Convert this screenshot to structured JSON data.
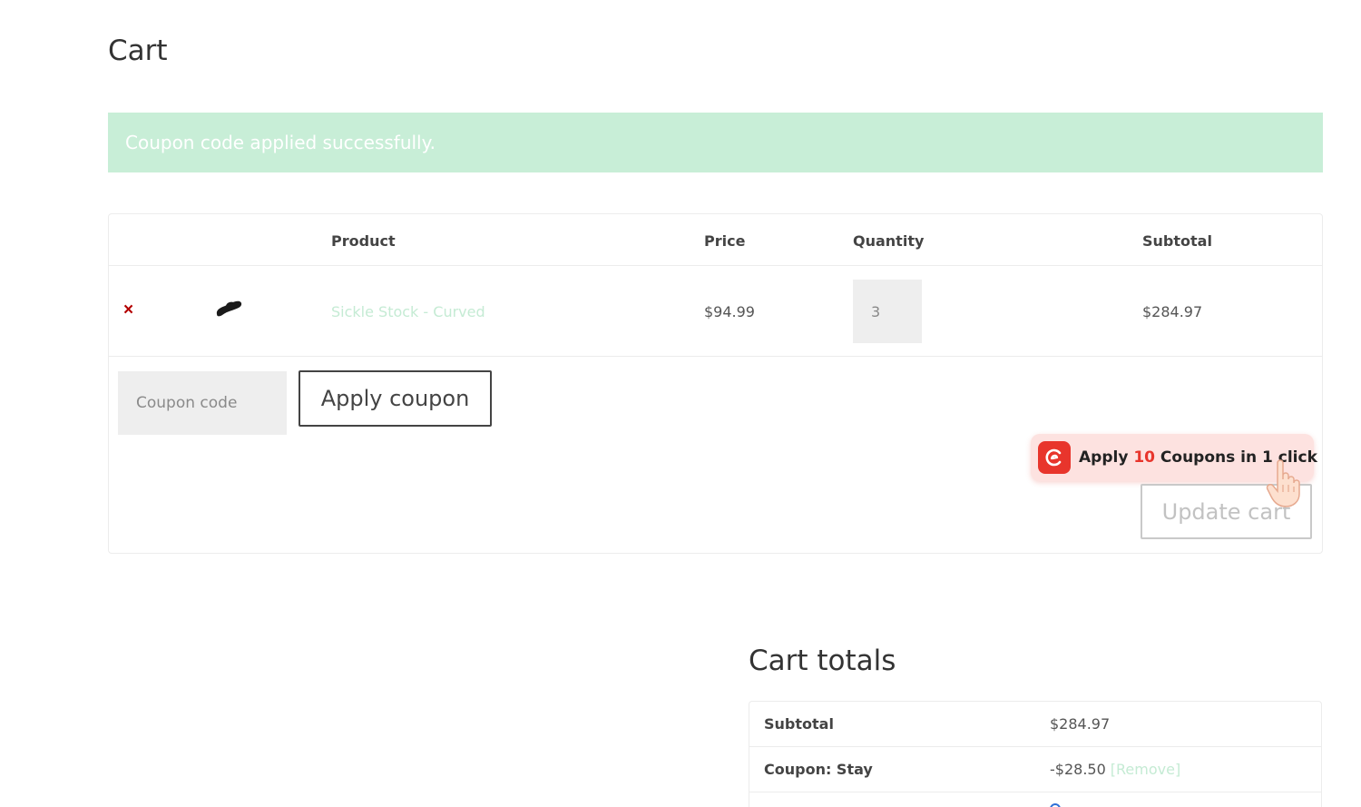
{
  "page": {
    "title": "Cart"
  },
  "notice": {
    "message": "Coupon code applied successfully."
  },
  "cart_table": {
    "headers": {
      "product": "Product",
      "price": "Price",
      "quantity": "Quantity",
      "subtotal": "Subtotal"
    },
    "rows": [
      {
        "remove_symbol": "×",
        "product_name": "Sickle Stock - Curved",
        "price": "$94.99",
        "quantity": "3",
        "subtotal": "$284.97"
      }
    ]
  },
  "coupon": {
    "placeholder": "Coupon code",
    "apply_label": "Apply coupon"
  },
  "promo": {
    "prefix": "Apply",
    "count": "10",
    "suffix": "Coupons in 1 click",
    "accent_color": "#e8352c"
  },
  "update_cart": {
    "label": "Update cart"
  },
  "totals": {
    "title": "Cart totals",
    "rows": [
      {
        "label": "Subtotal",
        "value": "$284.97"
      },
      {
        "label": "Coupon: Stay",
        "value": "-$28.50",
        "remove_label": "[Remove]"
      }
    ]
  },
  "colors": {
    "notice_bg": "#c8eed7",
    "link": "#c5ebd4",
    "remove_x": "#b30000"
  }
}
